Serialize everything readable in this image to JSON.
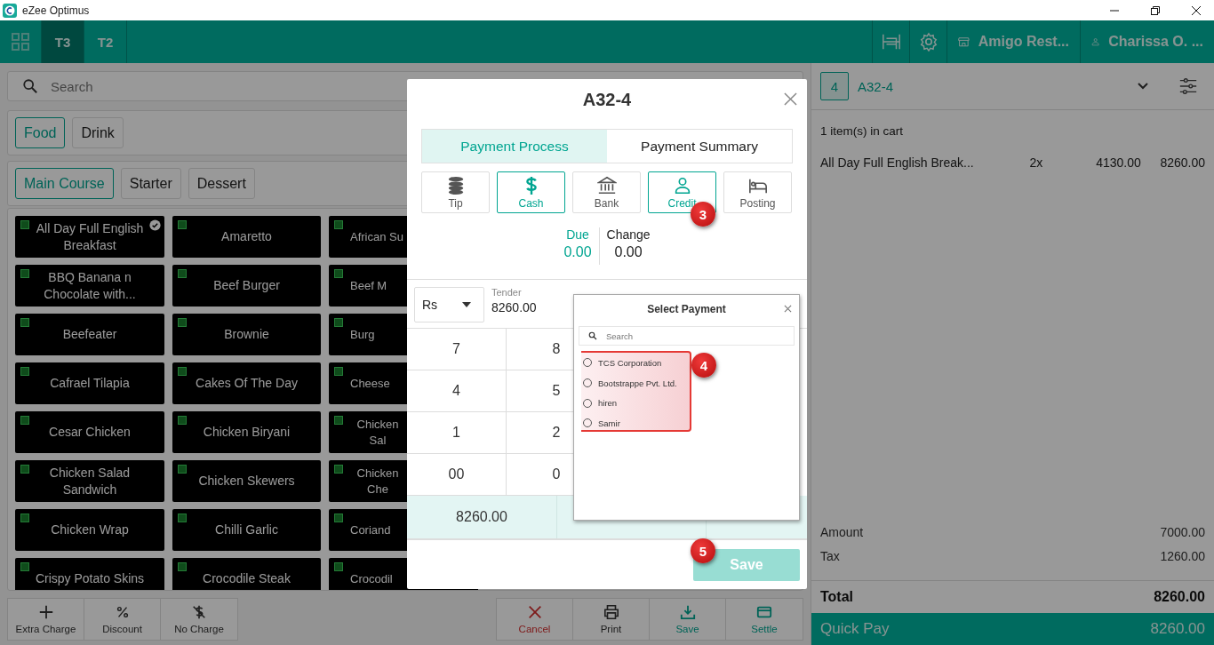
{
  "window": {
    "title": "eZee Optimus"
  },
  "top_bar": {
    "tabs": [
      {
        "label": "T3",
        "selected": true
      },
      {
        "label": "T2",
        "selected": false
      }
    ],
    "restaurant": "Amigo Rest...",
    "user": "Charissa O. ..."
  },
  "menu": {
    "search": {
      "placeholder": "Search"
    },
    "categories": [
      {
        "label": "Food",
        "selected": true
      },
      {
        "label": "Drink",
        "selected": false
      }
    ],
    "subcategories": [
      {
        "label": "Main Course",
        "selected": true
      },
      {
        "label": "Starter",
        "selected": false
      },
      {
        "label": "Dessert",
        "selected": false
      }
    ],
    "items": [
      {
        "name": "All Day Full English Breakfast",
        "in_cart": true
      },
      {
        "name": "Amaretto",
        "in_cart": false
      },
      {
        "name": "African Su"
      },
      {
        "name": "BBQ Banana n Chocolate with...",
        "in_cart": false
      },
      {
        "name": "Beef Burger",
        "in_cart": false
      },
      {
        "name": "Beef M"
      },
      {
        "name": "Beefeater",
        "in_cart": false
      },
      {
        "name": "Brownie",
        "in_cart": false
      },
      {
        "name": "Burg"
      },
      {
        "name": "Cafrael Tilapia",
        "in_cart": false
      },
      {
        "name": "Cakes Of The Day",
        "in_cart": false
      },
      {
        "name": "Cheese"
      },
      {
        "name": "Cesar Chicken",
        "in_cart": false
      },
      {
        "name": "Chicken Biryani",
        "in_cart": false
      },
      {
        "name": "Chicken Sal"
      },
      {
        "name": "Chicken Salad Sandwich",
        "in_cart": false
      },
      {
        "name": "Chicken Skewers",
        "in_cart": false
      },
      {
        "name": "Chicken Che"
      },
      {
        "name": "Chicken Wrap",
        "in_cart": false
      },
      {
        "name": "Chilli Garlic",
        "in_cart": false
      },
      {
        "name": "Coriand"
      },
      {
        "name": "Crispy Potato Skins",
        "in_cart": false
      },
      {
        "name": "Crocodile Steak",
        "in_cart": false
      },
      {
        "name": "Crocodil"
      }
    ]
  },
  "left_actions": [
    {
      "label": "Extra Charge",
      "kind": "plus"
    },
    {
      "label": "Discount",
      "kind": "percent"
    },
    {
      "label": "No Charge",
      "kind": "nocharge"
    }
  ],
  "right_actions": [
    {
      "label": "Cancel",
      "kind": "cancel"
    },
    {
      "label": "Print",
      "kind": "print"
    },
    {
      "label": "Save",
      "kind": "save"
    },
    {
      "label": "Settle",
      "kind": "settle"
    }
  ],
  "order": {
    "count": "4",
    "name": "A32-4",
    "cart_summary": "1 item(s) in cart",
    "lines": [
      {
        "name": "All Day Full English Break...",
        "qty": "2x",
        "price": "4130.00",
        "total": "8260.00"
      }
    ],
    "totals": [
      {
        "label": "Amount",
        "value": "7000.00"
      },
      {
        "label": "Tax",
        "value": "1260.00"
      }
    ],
    "total": {
      "label": "Total",
      "value": "8260.00"
    },
    "quick_pay": {
      "label": "Quick Pay",
      "value": "8260.00"
    }
  },
  "dialog": {
    "title": "A32-4",
    "tabs": [
      {
        "label": "Payment Process",
        "selected": true
      },
      {
        "label": "Payment Summary",
        "selected": false
      }
    ],
    "methods": [
      {
        "label": "Tip",
        "kind": "tip",
        "selected": false
      },
      {
        "label": "Cash",
        "kind": "cash",
        "selected": true
      },
      {
        "label": "Bank",
        "kind": "bank",
        "selected": false
      },
      {
        "label": "Credit",
        "kind": "credit",
        "selected": true
      },
      {
        "label": "Posting",
        "kind": "posting",
        "selected": false
      }
    ],
    "due": {
      "label": "Due",
      "value": "0.00"
    },
    "change": {
      "label": "Change",
      "value": "0.00"
    },
    "currency": "Rs",
    "tender": {
      "label": "Tender",
      "value": "8260.00"
    },
    "keypad": [
      "7",
      "8",
      "4",
      "5",
      "1",
      "2",
      "00",
      "0"
    ],
    "amount": "8260.00",
    "save": {
      "label": "Save",
      "disabled": true
    }
  },
  "select_payment": {
    "title": "Select Payment",
    "search": {
      "placeholder": "Search"
    },
    "options": [
      {
        "label": "TCS Corporation",
        "selected": false
      },
      {
        "label": "Bootstrappe Pvt. Ltd.",
        "selected": false
      },
      {
        "label": "hiren",
        "selected": false
      },
      {
        "label": "Samir",
        "selected": false
      }
    ]
  },
  "annotations": [
    {
      "label": "3"
    },
    {
      "label": "4"
    },
    {
      "label": "5"
    }
  ]
}
